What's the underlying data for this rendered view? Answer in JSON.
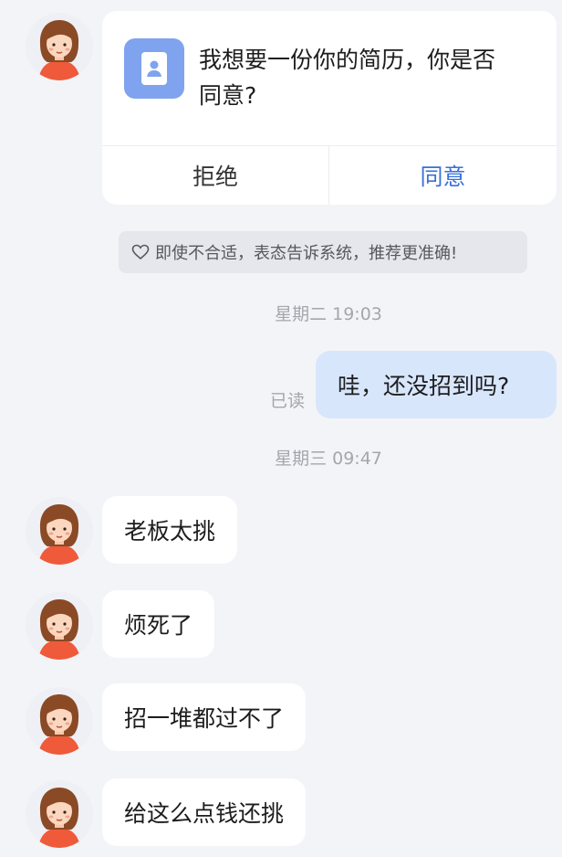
{
  "request_card": {
    "text": "我想要一份你的简历，你是否同意?",
    "reject_label": "拒绝",
    "agree_label": "同意",
    "icon": "resume-document-icon"
  },
  "hint": {
    "icon": "heart-outline-icon",
    "text": "即使不合适，表态告诉系统，推荐更准确!"
  },
  "timestamps": [
    "星期二 19:03",
    "星期三 09:47"
  ],
  "messages": [
    {
      "from": "me",
      "text": "哇，还没招到吗?",
      "status": "已读"
    },
    {
      "from": "them",
      "text": "老板太挑"
    },
    {
      "from": "them",
      "text": "烦死了"
    },
    {
      "from": "them",
      "text": "招一堆都过不了"
    },
    {
      "from": "them",
      "text": "给这么点钱还挑"
    }
  ],
  "colors": {
    "background": "#f3f4f7",
    "accent": "#3a6fd8",
    "my_bubble": "#d8e6fb",
    "icon_blue": "#7fa3ee"
  }
}
